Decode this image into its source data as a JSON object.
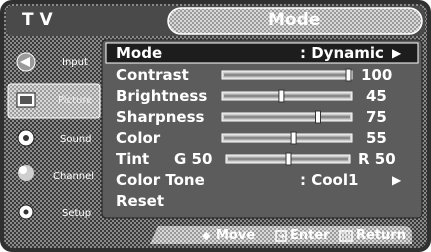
{
  "header": {
    "source": "T V",
    "title": "Mode"
  },
  "sidebar": {
    "items": [
      {
        "label": "Input",
        "icon": "input-icon"
      },
      {
        "label": "Picture",
        "icon": "picture-icon",
        "selected": true
      },
      {
        "label": "Sound",
        "icon": "sound-icon"
      },
      {
        "label": "Channel",
        "icon": "channel-icon"
      },
      {
        "label": "Setup",
        "icon": "setup-icon"
      }
    ]
  },
  "menu": {
    "mode": {
      "label": "Mode",
      "value": ": Dynamic",
      "arrow": "▶"
    },
    "contrast": {
      "label": "Contrast",
      "value": "100",
      "level": 1.0
    },
    "brightness": {
      "label": "Brightness",
      "value": "45",
      "level": 0.45
    },
    "sharpness": {
      "label": "Sharpness",
      "value": "75",
      "level": 0.75
    },
    "color": {
      "label": "Color",
      "value": "55",
      "level": 0.55
    },
    "tint": {
      "label": "Tint",
      "left": "G 50",
      "right": "R 50",
      "level": 0.5
    },
    "color_tone": {
      "label": "Color Tone",
      "value": ": Cool1",
      "arrow": "▶"
    },
    "reset": {
      "label": "Reset"
    }
  },
  "footer": {
    "move": "Move",
    "enter": "Enter",
    "return": "Return",
    "move_icon": "◆",
    "enter_icon": "enter-icon",
    "return_icon": "return-icon"
  },
  "colors": {
    "frame": "#333333",
    "panel": "#606060",
    "highlight": "#1e1e1e",
    "sidebar_selected": "#cfcfcf",
    "white": "#ffffff"
  }
}
